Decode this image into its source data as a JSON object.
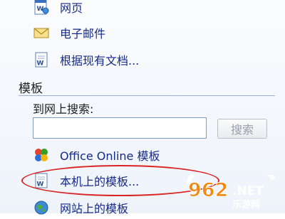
{
  "taskpane": {
    "new_items": [
      {
        "label": "网页",
        "icon": "web-page-icon"
      },
      {
        "label": "电子邮件",
        "icon": "email-envelope-icon"
      },
      {
        "label": "根据现有文档...",
        "icon": "document-icon"
      }
    ],
    "templates_section": {
      "title": "模板",
      "search_label": "到网上搜索:",
      "search_value": "",
      "search_button": "搜索",
      "items": [
        {
          "label": "Office Online 模板",
          "icon": "office-online-icon"
        },
        {
          "label": "本机上的模板...",
          "icon": "document-icon",
          "highlighted": true
        },
        {
          "label": "网站上的模板",
          "icon": "globe-icon"
        }
      ]
    }
  },
  "watermark": {
    "number": "962",
    "suffix": ".NET",
    "tagline": "乐游网"
  },
  "colors": {
    "link": "#152a8a",
    "highlight_circle": "#d92424",
    "watermark_accent": "#f08a12"
  }
}
